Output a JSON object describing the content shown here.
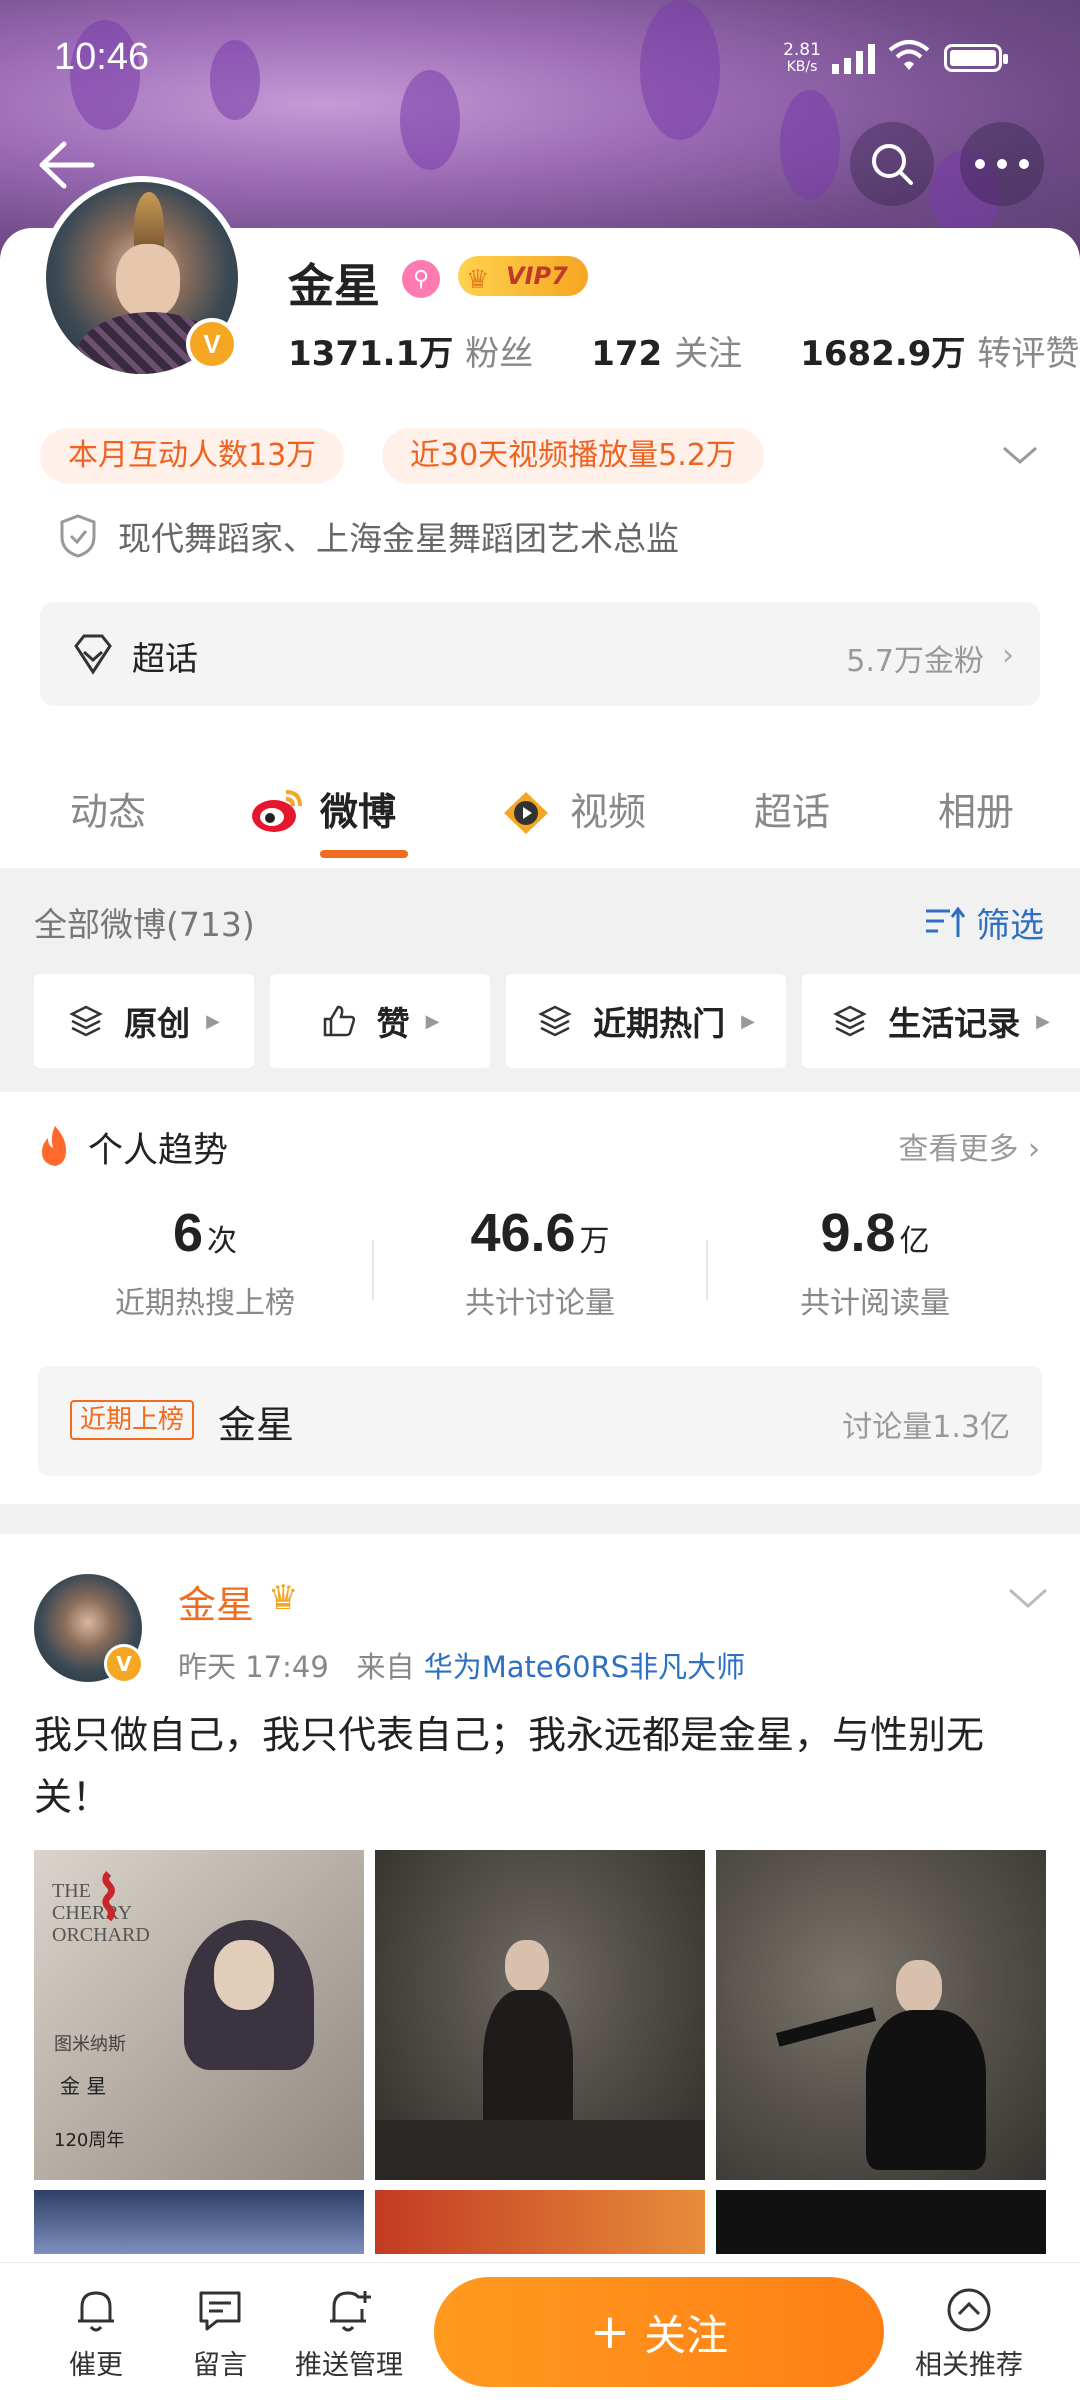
{
  "status": {
    "time": "10:46",
    "net_speed_value": "2.81",
    "net_speed_unit": "KB/s"
  },
  "header": {
    "back_icon": "arrow-left-icon",
    "search_icon": "search-icon",
    "more_icon": "more-dots-icon"
  },
  "profile": {
    "name": "金星",
    "vip_label": "VIP7",
    "verified_badge": "V",
    "stats": [
      {
        "value": "1371.1万",
        "label": "粉丝"
      },
      {
        "value": "172",
        "label": "关注"
      },
      {
        "value": "1682.9万",
        "label": "转评赞"
      }
    ],
    "chips": [
      "本月互动人数13万",
      "近30天视频播放量5.2万"
    ],
    "verification": "现代舞蹈家、上海金星舞蹈团艺术总监",
    "super_topic": {
      "label": "超话",
      "right": "5.7万金粉"
    }
  },
  "tabs": [
    {
      "label": "动态"
    },
    {
      "label": "微博"
    },
    {
      "label": "视频"
    },
    {
      "label": "超话"
    },
    {
      "label": "相册"
    }
  ],
  "filter": {
    "count_label": "全部微博(713)",
    "filter_label": "筛选",
    "pills": [
      "原创",
      "赞",
      "近期热门",
      "生活记录"
    ]
  },
  "trend": {
    "title": "个人趋势",
    "more": "查看更多",
    "stats": [
      {
        "value": "6",
        "unit": "次",
        "label": "近期热搜上榜"
      },
      {
        "value": "46.6",
        "unit": "万",
        "label": "共计讨论量"
      },
      {
        "value": "9.8",
        "unit": "亿",
        "label": "共计阅读量"
      }
    ],
    "hot_tag": "近期上榜",
    "hot_keyword": "金星",
    "hot_discussion": "讨论量1.3亿"
  },
  "post": {
    "author": "金星",
    "time": "昨天 17:49",
    "from_label": "来自",
    "source": "华为Mate60RS非凡大师",
    "text": "我只做自己，我只代表自己；我永远都是金星，与性别无关！",
    "poster_lines": [
      "THE CHERRY ORCHARD",
      "图米纳斯",
      "金 星",
      "120周年"
    ]
  },
  "bottom": {
    "items": [
      {
        "label": "催更",
        "icon": "bell-icon"
      },
      {
        "label": "留言",
        "icon": "comment-icon"
      },
      {
        "label": "推送管理",
        "icon": "push-bell-icon"
      },
      {
        "label": "相关推荐",
        "icon": "chevron-up-circle-icon"
      }
    ],
    "follow_label": "关注",
    "follow_plus": "+"
  },
  "colors": {
    "accent": "#f26c1f",
    "link": "#2d6fc1",
    "follow_button": "#ff8a1a"
  }
}
